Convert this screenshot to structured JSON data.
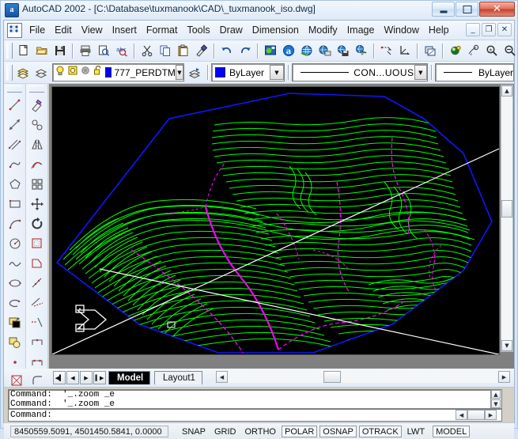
{
  "window": {
    "title": "AutoCAD 2002 - [C:\\Database\\tuxmanook\\CAD\\_tuxmanook_iso.dwg]",
    "app_icon": "autocad-icon",
    "minimize_label": "–",
    "maximize_label": "□",
    "close_label": "✕"
  },
  "menu": {
    "doc_icon": "drawing-document-icon",
    "items": [
      "File",
      "Edit",
      "View",
      "Insert",
      "Format",
      "Tools",
      "Draw",
      "Dimension",
      "Modify",
      "Image",
      "Window",
      "Help"
    ],
    "mdi_buttons": [
      "_",
      "❐",
      "✕"
    ]
  },
  "standard_toolbar": {
    "buttons": [
      {
        "name": "new-icon",
        "label": "New"
      },
      {
        "name": "open-icon",
        "label": "Open"
      },
      {
        "name": "save-icon",
        "label": "Save"
      },
      {
        "name": "print-icon",
        "label": "Plot"
      },
      {
        "name": "print-preview-icon",
        "label": "Plot Preview"
      },
      {
        "name": "spelling-icon",
        "label": "Spelling"
      },
      {
        "name": "cut-icon",
        "label": "Cut"
      },
      {
        "name": "copy-icon",
        "label": "Copy"
      },
      {
        "name": "paste-icon",
        "label": "Paste"
      },
      {
        "name": "match-properties-icon",
        "label": "Match Properties"
      },
      {
        "name": "undo-icon",
        "label": "Undo"
      },
      {
        "name": "redo-icon",
        "label": "Redo"
      },
      {
        "name": "launch-browser-icon",
        "label": "Launch Browser"
      },
      {
        "name": "today-icon",
        "label": "AutoCAD Today"
      },
      {
        "name": "meet-now-icon",
        "label": "Meet Now"
      },
      {
        "name": "publish-web-icon",
        "label": "Publish to Web"
      },
      {
        "name": "etransmit-icon",
        "label": "eTransmit"
      },
      {
        "name": "insert-hyperlink-icon",
        "label": "Insert Hyperlink"
      },
      {
        "name": "dist-icon",
        "label": "Distance"
      },
      {
        "name": "ucs-icon",
        "label": "UCS"
      },
      {
        "name": "named-views-icon",
        "label": "Named Views"
      },
      {
        "name": "pan-realtime-icon",
        "label": "Pan Realtime"
      },
      {
        "name": "zoom-realtime-icon",
        "label": "Zoom Realtime"
      },
      {
        "name": "zoom-window-icon",
        "label": "Zoom Window"
      },
      {
        "name": "zoom-previous-icon",
        "label": "Zoom Previous"
      }
    ]
  },
  "properties_toolbar": {
    "layer_prev_icon": "make-object-layer-current-icon",
    "layers_icon": "layers-dialog-icon",
    "layer_state": {
      "on_icon": "lightbulb-on-icon",
      "freeze_icon": "sun-freeze-icon",
      "freeze_vp_icon": "freeze-viewport-icon",
      "lock_icon": "unlocked-padlock-icon",
      "color_swatch": "#0000ff",
      "name": "777_PERDTM",
      "dropdown_arrow": "▼"
    },
    "layer_previous_icon": "layer-previous-icon",
    "color_control": {
      "swatch": "#0000ff",
      "value": "ByLayer",
      "dropdown_arrow": "▼"
    },
    "linetype_control": {
      "value": "CON...UOUS",
      "dropdown_arrow": "▼"
    },
    "lineweight_control": {
      "value": "ByLayer"
    }
  },
  "draw_toolbar": {
    "buttons": [
      {
        "name": "line-icon"
      },
      {
        "name": "construction-line-icon"
      },
      {
        "name": "multiline-icon"
      },
      {
        "name": "polyline-icon"
      },
      {
        "name": "polygon-icon"
      },
      {
        "name": "rectangle-icon"
      },
      {
        "name": "arc-icon"
      },
      {
        "name": "circle-icon"
      },
      {
        "name": "spline-icon"
      },
      {
        "name": "ellipse-icon"
      },
      {
        "name": "ellipse-arc-icon"
      },
      {
        "name": "insert-block-icon"
      },
      {
        "name": "make-block-icon"
      },
      {
        "name": "point-icon"
      },
      {
        "name": "hatch-icon"
      },
      {
        "name": "region-icon"
      }
    ]
  },
  "modify_toolbar": {
    "buttons": [
      {
        "name": "erase-icon"
      },
      {
        "name": "copy-object-icon"
      },
      {
        "name": "mirror-icon"
      },
      {
        "name": "offset-icon"
      },
      {
        "name": "array-icon"
      },
      {
        "name": "move-icon"
      },
      {
        "name": "rotate-icon"
      },
      {
        "name": "scale-icon"
      },
      {
        "name": "stretch-icon"
      },
      {
        "name": "lengthen-icon"
      },
      {
        "name": "trim-icon"
      },
      {
        "name": "extend-icon"
      },
      {
        "name": "break-icon"
      },
      {
        "name": "break-at-point-icon"
      },
      {
        "name": "chamfer-icon"
      },
      {
        "name": "fillet-icon"
      }
    ]
  },
  "drawing": {
    "background": "#000000",
    "contour_color": "#00ff00",
    "drainage_color": "#ff00ff",
    "boundary_color": "#0000ff",
    "crosshair_color": "#ffffff",
    "ucs_icon": "ucs-isometric-icon",
    "view": "isometric"
  },
  "scrollbars": {
    "up_arrow": "▲",
    "down_arrow": "▼",
    "left_arrow": "◀",
    "right_arrow": "▶"
  },
  "tabs": {
    "nav": [
      "⏮",
      "◀",
      "▶",
      "⏭"
    ],
    "items": [
      {
        "label": "Model",
        "active": true
      },
      {
        "label": "Layout1",
        "active": false
      }
    ]
  },
  "command_window": {
    "history": [
      "Command:  '_.zoom _e",
      "Command:  '_.zoom _e"
    ],
    "prompt": "Command:"
  },
  "status_bar": {
    "coordinates": "8450559.5091, 4501450.5841, 0.0000",
    "toggles": [
      {
        "label": "SNAP",
        "on": false
      },
      {
        "label": "GRID",
        "on": false
      },
      {
        "label": "ORTHO",
        "on": false
      },
      {
        "label": "POLAR",
        "on": true
      },
      {
        "label": "OSNAP",
        "on": true
      },
      {
        "label": "OTRACK",
        "on": true
      },
      {
        "label": "LWT",
        "on": false
      },
      {
        "label": "MODEL",
        "on": true
      }
    ]
  }
}
